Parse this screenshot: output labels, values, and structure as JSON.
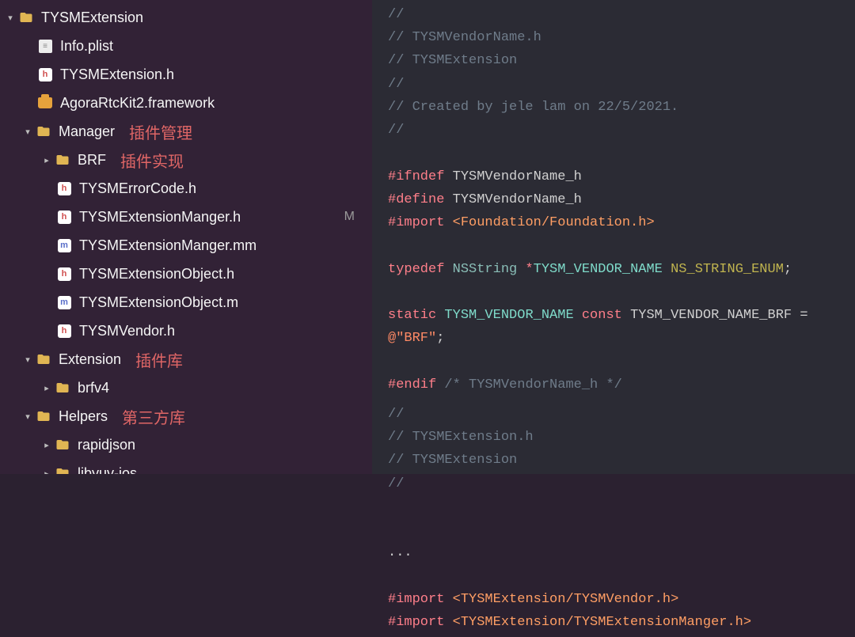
{
  "sidebar": {
    "root": {
      "name": "TYSMExtension",
      "items": [
        {
          "name": "Info.plist",
          "type": "plist"
        },
        {
          "name": "TYSMExtension.h",
          "type": "h"
        },
        {
          "name": "AgoraRtcKit2.framework",
          "type": "framework"
        },
        {
          "name": "Manager",
          "type": "folder",
          "open": true,
          "annotation": "插件管理",
          "items": [
            {
              "name": "BRF",
              "type": "folder",
              "open": false,
              "annotation": "插件实现"
            },
            {
              "name": "TYSMErrorCode.h",
              "type": "h"
            },
            {
              "name": "TYSMExtensionManger.h",
              "type": "h",
              "vcs": "M"
            },
            {
              "name": "TYSMExtensionManger.mm",
              "type": "m"
            },
            {
              "name": "TYSMExtensionObject.h",
              "type": "h"
            },
            {
              "name": "TYSMExtensionObject.m",
              "type": "m"
            },
            {
              "name": "TYSMVendor.h",
              "type": "h"
            }
          ]
        },
        {
          "name": "Extension",
          "type": "folder",
          "open": true,
          "annotation": "插件库",
          "items": [
            {
              "name": "brfv4",
              "type": "folder",
              "open": false
            }
          ]
        },
        {
          "name": "Helpers",
          "type": "folder",
          "open": true,
          "annotation": "第三方库",
          "items": [
            {
              "name": "rapidjson",
              "type": "folder",
              "open": false
            },
            {
              "name": "libyuv-ios",
              "type": "folder",
              "open": false
            }
          ]
        }
      ]
    }
  },
  "editor": {
    "top": {
      "c1": "//",
      "c2": "//  TYSMVendorName.h",
      "c3": "//  TYSMExtension",
      "c4": "//",
      "c5": "//  Created by jele lam on 22/5/2021.",
      "c6": "//",
      "ifndef_kw": "#ifndef",
      "ifndef_sym": "TYSMVendorName_h",
      "define_kw": "#define",
      "define_sym": "TYSMVendorName_h",
      "import_kw": "#import",
      "import_hdr": "<Foundation/Foundation.h>",
      "typedef_kw": "typedef",
      "typedef_type": "NSString",
      "typedef_star": "*",
      "typedef_name": "TYSM_VENDOR_NAME",
      "typedef_enum": "NS_STRING_ENUM",
      "static_kw": "static",
      "static_type": "TYSM_VENDOR_NAME",
      "const_kw": "const",
      "const_name": "TYSM_VENDOR_NAME_BRF",
      "const_eq": "=",
      "const_val": "@\"BRF\"",
      "endif_kw": "#endif",
      "endif_cmt": "/* TYSMVendorName_h */"
    },
    "bottom": {
      "c1": "//",
      "c2": "//  TYSMExtension.h",
      "c3": "//  TYSMExtension",
      "c4": "//",
      "ellipsis": "...",
      "import_kw": "#import",
      "import1": "<TYSMExtension/TYSMVendor.h>",
      "import2": "<TYSMExtension/TYSMExtensionManger.h>"
    }
  }
}
